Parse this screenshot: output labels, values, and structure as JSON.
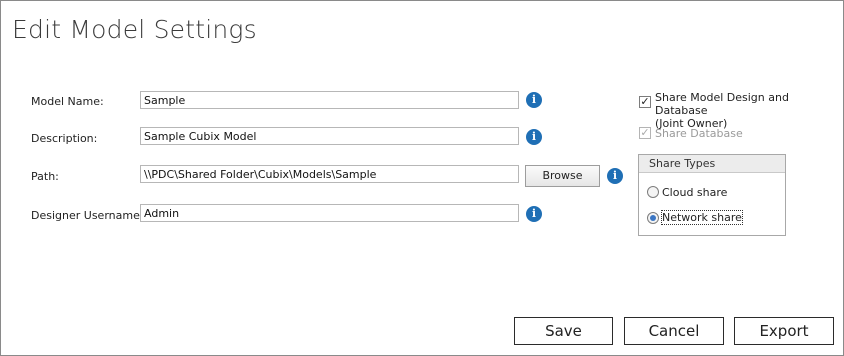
{
  "dialog": {
    "title": "Edit Model Settings"
  },
  "fields": [
    {
      "label": "Model Name:",
      "value": "Sample"
    },
    {
      "label": "Description:",
      "value": "Sample Cubix Model"
    },
    {
      "label": "Path:",
      "value": "\\\\PDC\\Shared Folder\\Cubix\\Models\\Sample"
    },
    {
      "label": "Designer Username:",
      "value": "Admin"
    }
  ],
  "browse_label": "Browse",
  "info_glyph": "i",
  "share": {
    "design_label_line1": "Share Model Design and Database",
    "design_label_line2": "(Joint Owner)",
    "design_checked": true,
    "database_label": "Share Database",
    "database_checked": true,
    "database_enabled": false,
    "check_glyph": "✓"
  },
  "share_types": {
    "title": "Share Types",
    "options": [
      "Cloud share",
      "Network share"
    ],
    "selected": "Network share"
  },
  "buttons": {
    "save": "Save",
    "cancel": "Cancel",
    "export": "Export"
  },
  "colors": {
    "info": "#1f6fb5",
    "radio_dot": "#3b76c4",
    "border": "#8a8a8a"
  }
}
